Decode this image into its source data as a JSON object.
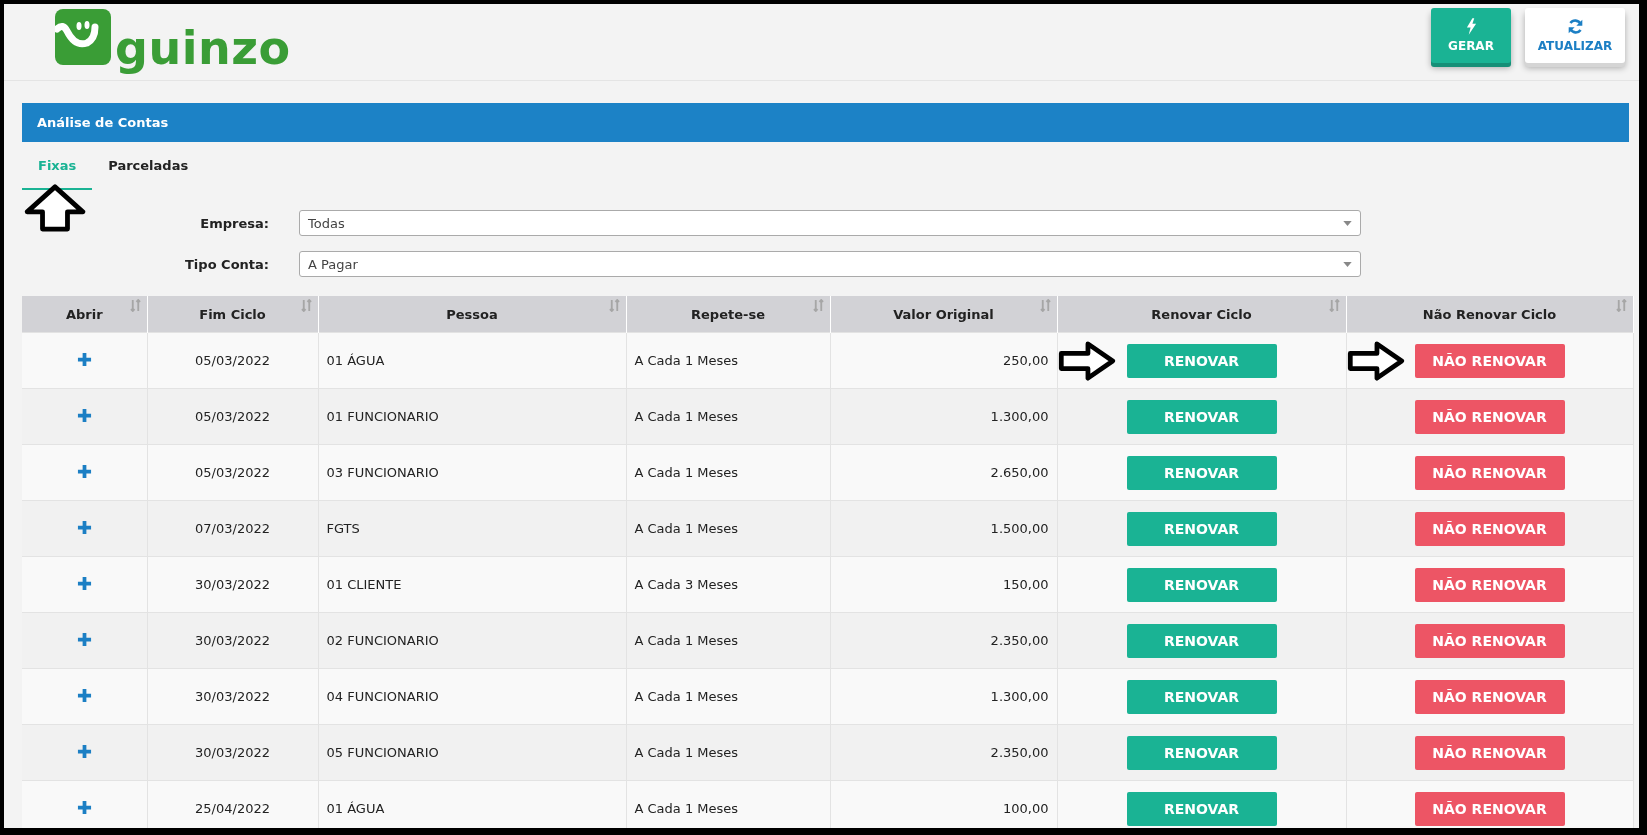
{
  "logo": {
    "text": "guinzo"
  },
  "actions": [
    {
      "kind": "generate",
      "label": "GERAR"
    },
    {
      "kind": "refresh",
      "label": "ATUALIZAR"
    }
  ],
  "panel": {
    "title": "Análise de Contas"
  },
  "tabs": [
    {
      "label": "Fixas",
      "selected": true,
      "annotated": true
    },
    {
      "label": "Parceladas",
      "selected": false,
      "annotated": false
    }
  ],
  "filters": [
    {
      "label": "Empresa:",
      "value": "Todas"
    },
    {
      "label": "Tipo Conta:",
      "value": "A Pagar"
    }
  ],
  "table": {
    "columns": [
      "Abrir",
      "Fim Ciclo",
      "Pessoa",
      "Repete-se",
      "Valor Original",
      "Renovar Ciclo",
      "Não Renovar Ciclo"
    ],
    "rows": [
      {
        "end": "05/03/2022",
        "person": "01 ÁGUA",
        "repeat": "A Cada 1 Meses",
        "value": "250,00",
        "renew": "RENOVAR",
        "no_renew": "NÃO RENOVAR",
        "annotated": true
      },
      {
        "end": "05/03/2022",
        "person": "01 FUNCIONARIO",
        "repeat": "A Cada 1 Meses",
        "value": "1.300,00",
        "renew": "RENOVAR",
        "no_renew": "NÃO RENOVAR",
        "annotated": false
      },
      {
        "end": "05/03/2022",
        "person": "03 FUNCIONARIO",
        "repeat": "A Cada 1 Meses",
        "value": "2.650,00",
        "renew": "RENOVAR",
        "no_renew": "NÃO RENOVAR",
        "annotated": false
      },
      {
        "end": "07/03/2022",
        "person": "FGTS",
        "repeat": "A Cada 1 Meses",
        "value": "1.500,00",
        "renew": "RENOVAR",
        "no_renew": "NÃO RENOVAR",
        "annotated": false
      },
      {
        "end": "30/03/2022",
        "person": "01 CLIENTE",
        "repeat": "A Cada 3 Meses",
        "value": "150,00",
        "renew": "RENOVAR",
        "no_renew": "NÃO RENOVAR",
        "annotated": false
      },
      {
        "end": "30/03/2022",
        "person": "02 FUNCIONARIO",
        "repeat": "A Cada 1 Meses",
        "value": "2.350,00",
        "renew": "RENOVAR",
        "no_renew": "NÃO RENOVAR",
        "annotated": false
      },
      {
        "end": "30/03/2022",
        "person": "04 FUNCIONARIO",
        "repeat": "A Cada 1 Meses",
        "value": "1.300,00",
        "renew": "RENOVAR",
        "no_renew": "NÃO RENOVAR",
        "annotated": false
      },
      {
        "end": "30/03/2022",
        "person": "05 FUNCIONARIO",
        "repeat": "A Cada 1 Meses",
        "value": "2.350,00",
        "renew": "RENOVAR",
        "no_renew": "NÃO RENOVAR",
        "annotated": false
      },
      {
        "end": "25/04/2022",
        "person": "01 ÁGUA",
        "repeat": "A Cada 1 Meses",
        "value": "100,00",
        "renew": "RENOVAR",
        "no_renew": "NÃO RENOVAR",
        "annotated": false
      }
    ]
  }
}
